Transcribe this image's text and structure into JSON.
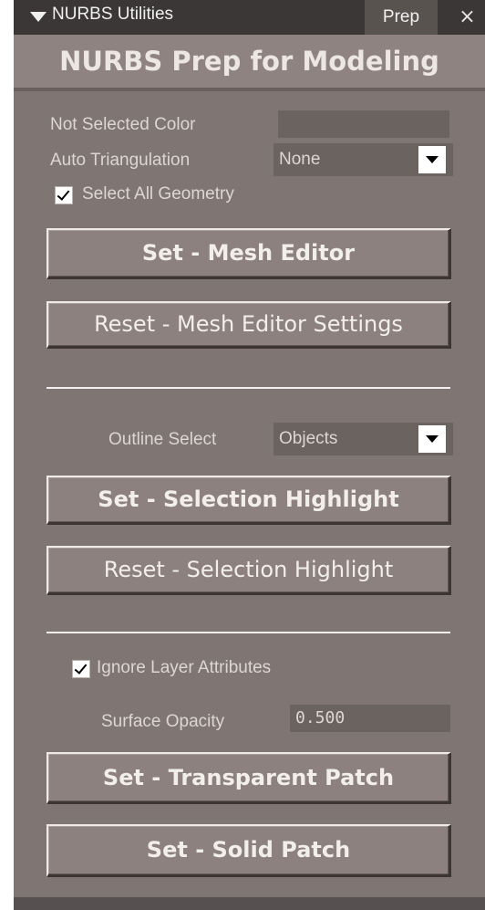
{
  "window": {
    "title": "NURBS Utilities",
    "tab": "Prep",
    "close_glyph": "×",
    "header": "NURBS Prep for Modeling"
  },
  "mesh": {
    "not_selected_color_label": "Not Selected Color",
    "auto_triangulation_label": "Auto Triangulation",
    "auto_triangulation_value": "None",
    "select_all_label": "Select All Geometry",
    "select_all_checked": true,
    "set_button": "Set - Mesh Editor",
    "reset_button": "Reset - Mesh Editor Settings"
  },
  "selection": {
    "outline_select_label": "Outline Select",
    "outline_select_value": "Objects",
    "set_button": "Set - Selection Highlight",
    "reset_button": "Reset - Selection Highlight"
  },
  "patch": {
    "ignore_layer_label": "Ignore Layer Attributes",
    "ignore_layer_checked": true,
    "surface_opacity_label": "Surface Opacity",
    "surface_opacity_value": "0.500",
    "transparent_button": "Set - Transparent Patch",
    "solid_button": "Set - Solid Patch"
  },
  "colors": {
    "panel_bg": "#7f7572",
    "title_bar": "#3b3736",
    "header_bg": "#8e8380",
    "field_bg": "#6b6360"
  },
  "icons": {
    "collapse": "triangle-down-icon",
    "close": "close-icon",
    "dropdown": "chevron-down-icon",
    "check": "checkmark-icon"
  }
}
